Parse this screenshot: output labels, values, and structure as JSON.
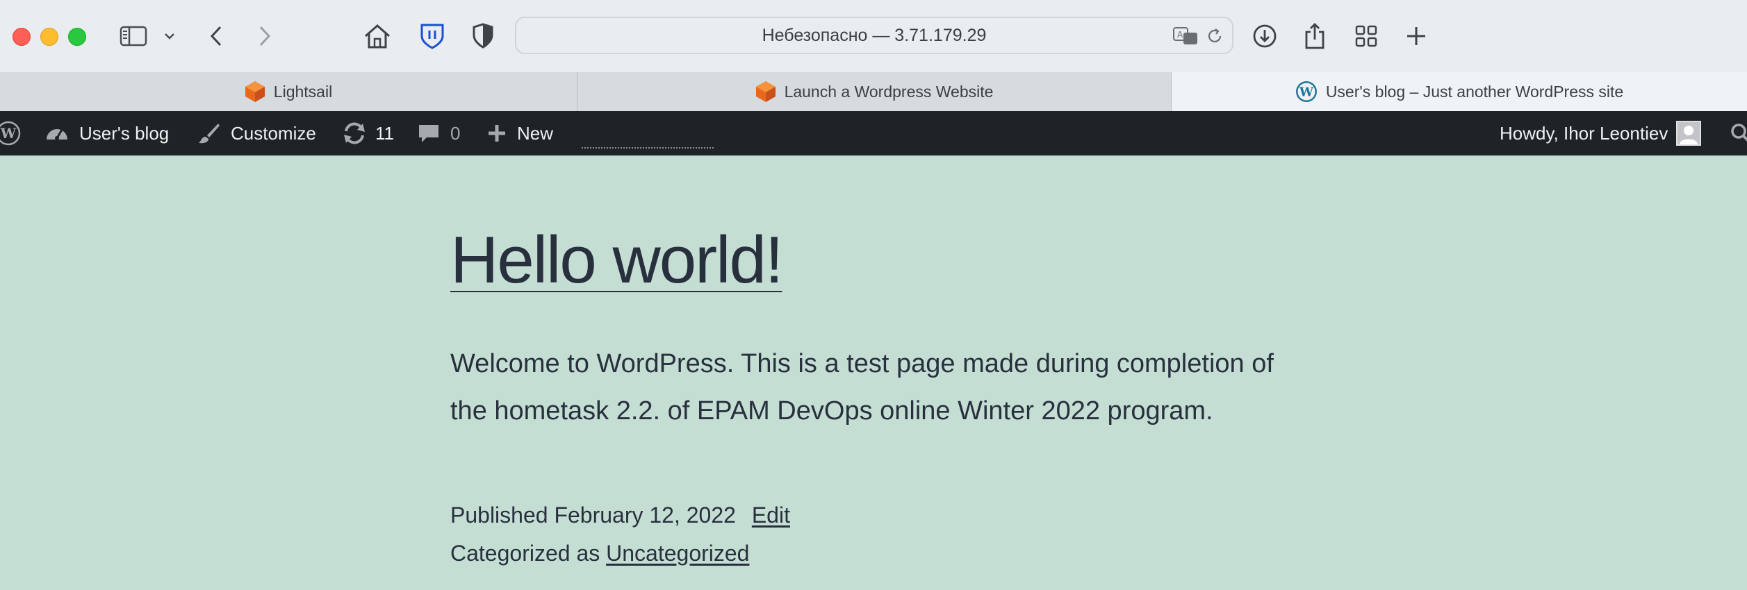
{
  "browser": {
    "address": "Небезопасно — 3.71.179.29",
    "tabs": [
      {
        "label": "Lightsail",
        "icon": "aws-cube-icon"
      },
      {
        "label": "Launch a Wordpress Website",
        "icon": "aws-cube-icon"
      },
      {
        "label": "User's blog – Just another WordPress site",
        "icon": "wordpress-icon",
        "active": true
      }
    ]
  },
  "adminbar": {
    "site_name": "User's blog",
    "customize": "Customize",
    "updates_count": "11",
    "comments_count": "0",
    "new_label": "New",
    "howdy": "Howdy, Ihor Leontiev"
  },
  "post": {
    "title": "Hello world!",
    "body": "Welcome to WordPress. This is a test page made during completion of the hometask 2.2. of EPAM DevOps online Winter 2022 program.",
    "published_prefix": "Published",
    "published_date": "February 12, 2022",
    "edit_label": "Edit",
    "categorized_prefix": "Categorized as",
    "category": "Uncategorized"
  },
  "colors": {
    "page_bg": "#c5ded4",
    "adminbar_bg": "#1d2327",
    "text": "#28303d",
    "aws_orange": "#e8691d",
    "wp_blue": "#21759b"
  }
}
